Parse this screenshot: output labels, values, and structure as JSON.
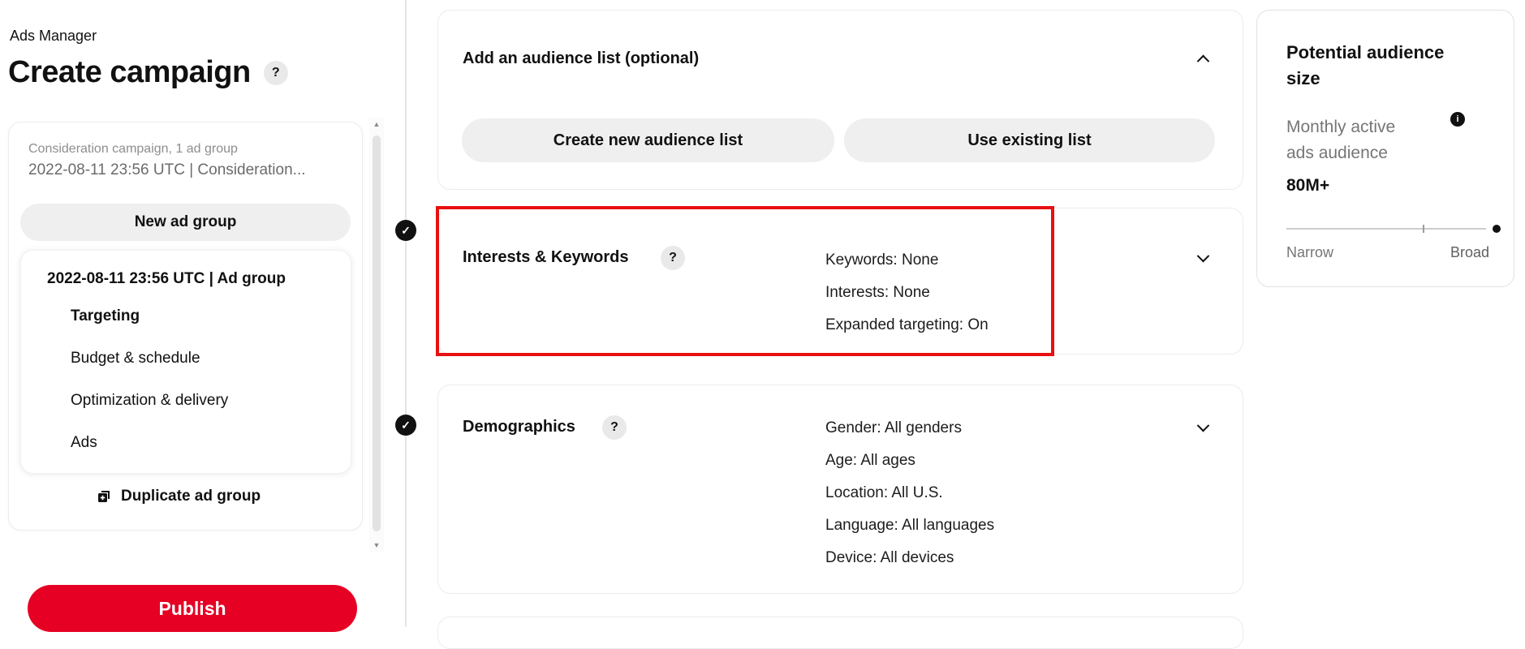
{
  "app": {
    "name": "Ads Manager",
    "page_title": "Create campaign"
  },
  "icons": {
    "help": "?",
    "check": "✓",
    "info": "i",
    "scroll_up": "▲",
    "scroll_down": "▼"
  },
  "colors": {
    "accent_red": "#e60023",
    "highlight_red": "#e81010",
    "button_gray": "#efefef",
    "icon_black": "#111111",
    "muted_text": "#767676"
  },
  "sidebar": {
    "campaign_summary": {
      "line1": "Consideration campaign, 1 ad group",
      "line2": "2022-08-11 23:56 UTC | Consideration..."
    },
    "new_ad_group_label": "New ad group",
    "ad_group": {
      "title": "2022-08-11 23:56 UTC | Ad group",
      "items": [
        {
          "label": "Targeting",
          "active": true
        },
        {
          "label": "Budget & schedule",
          "active": false
        },
        {
          "label": "Optimization & delivery",
          "active": false
        },
        {
          "label": "Ads",
          "active": false
        }
      ]
    },
    "duplicate_label": "Duplicate ad group",
    "publish_label": "Publish"
  },
  "main": {
    "audience_list_card": {
      "title": "Add an audience list (optional)",
      "buttons": [
        "Create new audience list",
        "Use existing list"
      ],
      "expanded": true
    },
    "interests_card": {
      "title": "Interests & Keywords",
      "summary": [
        "Keywords: None",
        "Interests: None",
        "Expanded targeting: On"
      ],
      "completed": true,
      "highlighted": true
    },
    "demographics_card": {
      "title": "Demographics",
      "summary": [
        "Gender: All genders",
        "Age: All ages",
        "Location: All U.S.",
        "Language: All languages",
        "Device: All devices"
      ],
      "completed": true
    }
  },
  "right_panel": {
    "title": "Potential audience size",
    "subtitle": "Monthly active ads audience",
    "value": "80M+",
    "slider": {
      "min_label": "Narrow",
      "max_label": "Broad",
      "position_pct": 90
    }
  }
}
